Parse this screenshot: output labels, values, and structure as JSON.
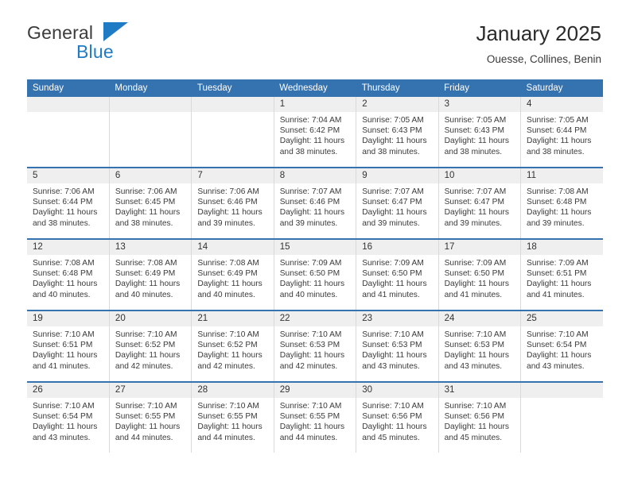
{
  "brand": {
    "name_part1": "General",
    "name_part2": "Blue",
    "triangle_icon": "triangle-icon",
    "accent_color": "#1f7cc4"
  },
  "header": {
    "title": "January 2025",
    "location": "Ouesse, Collines, Benin"
  },
  "theme": {
    "header_blue": "#3572b0",
    "daynum_gray": "#efefef",
    "text": "#333333"
  },
  "weekday_headers": [
    "Sunday",
    "Monday",
    "Tuesday",
    "Wednesday",
    "Thursday",
    "Friday",
    "Saturday"
  ],
  "labels": {
    "sunrise_prefix": "Sunrise:",
    "sunset_prefix": "Sunset:",
    "daylight_prefix": "Daylight:"
  },
  "weeks": [
    [
      {
        "day": "",
        "empty": true
      },
      {
        "day": "",
        "empty": true
      },
      {
        "day": "",
        "empty": true
      },
      {
        "day": "1",
        "sunrise": "Sunrise: 7:04 AM",
        "sunset": "Sunset: 6:42 PM",
        "daylight_line1": "Daylight: 11 hours",
        "daylight_line2": "and 38 minutes."
      },
      {
        "day": "2",
        "sunrise": "Sunrise: 7:05 AM",
        "sunset": "Sunset: 6:43 PM",
        "daylight_line1": "Daylight: 11 hours",
        "daylight_line2": "and 38 minutes."
      },
      {
        "day": "3",
        "sunrise": "Sunrise: 7:05 AM",
        "sunset": "Sunset: 6:43 PM",
        "daylight_line1": "Daylight: 11 hours",
        "daylight_line2": "and 38 minutes."
      },
      {
        "day": "4",
        "sunrise": "Sunrise: 7:05 AM",
        "sunset": "Sunset: 6:44 PM",
        "daylight_line1": "Daylight: 11 hours",
        "daylight_line2": "and 38 minutes."
      }
    ],
    [
      {
        "day": "5",
        "sunrise": "Sunrise: 7:06 AM",
        "sunset": "Sunset: 6:44 PM",
        "daylight_line1": "Daylight: 11 hours",
        "daylight_line2": "and 38 minutes."
      },
      {
        "day": "6",
        "sunrise": "Sunrise: 7:06 AM",
        "sunset": "Sunset: 6:45 PM",
        "daylight_line1": "Daylight: 11 hours",
        "daylight_line2": "and 38 minutes."
      },
      {
        "day": "7",
        "sunrise": "Sunrise: 7:06 AM",
        "sunset": "Sunset: 6:46 PM",
        "daylight_line1": "Daylight: 11 hours",
        "daylight_line2": "and 39 minutes."
      },
      {
        "day": "8",
        "sunrise": "Sunrise: 7:07 AM",
        "sunset": "Sunset: 6:46 PM",
        "daylight_line1": "Daylight: 11 hours",
        "daylight_line2": "and 39 minutes."
      },
      {
        "day": "9",
        "sunrise": "Sunrise: 7:07 AM",
        "sunset": "Sunset: 6:47 PM",
        "daylight_line1": "Daylight: 11 hours",
        "daylight_line2": "and 39 minutes."
      },
      {
        "day": "10",
        "sunrise": "Sunrise: 7:07 AM",
        "sunset": "Sunset: 6:47 PM",
        "daylight_line1": "Daylight: 11 hours",
        "daylight_line2": "and 39 minutes."
      },
      {
        "day": "11",
        "sunrise": "Sunrise: 7:08 AM",
        "sunset": "Sunset: 6:48 PM",
        "daylight_line1": "Daylight: 11 hours",
        "daylight_line2": "and 39 minutes."
      }
    ],
    [
      {
        "day": "12",
        "sunrise": "Sunrise: 7:08 AM",
        "sunset": "Sunset: 6:48 PM",
        "daylight_line1": "Daylight: 11 hours",
        "daylight_line2": "and 40 minutes."
      },
      {
        "day": "13",
        "sunrise": "Sunrise: 7:08 AM",
        "sunset": "Sunset: 6:49 PM",
        "daylight_line1": "Daylight: 11 hours",
        "daylight_line2": "and 40 minutes."
      },
      {
        "day": "14",
        "sunrise": "Sunrise: 7:08 AM",
        "sunset": "Sunset: 6:49 PM",
        "daylight_line1": "Daylight: 11 hours",
        "daylight_line2": "and 40 minutes."
      },
      {
        "day": "15",
        "sunrise": "Sunrise: 7:09 AM",
        "sunset": "Sunset: 6:50 PM",
        "daylight_line1": "Daylight: 11 hours",
        "daylight_line2": "and 40 minutes."
      },
      {
        "day": "16",
        "sunrise": "Sunrise: 7:09 AM",
        "sunset": "Sunset: 6:50 PM",
        "daylight_line1": "Daylight: 11 hours",
        "daylight_line2": "and 41 minutes."
      },
      {
        "day": "17",
        "sunrise": "Sunrise: 7:09 AM",
        "sunset": "Sunset: 6:50 PM",
        "daylight_line1": "Daylight: 11 hours",
        "daylight_line2": "and 41 minutes."
      },
      {
        "day": "18",
        "sunrise": "Sunrise: 7:09 AM",
        "sunset": "Sunset: 6:51 PM",
        "daylight_line1": "Daylight: 11 hours",
        "daylight_line2": "and 41 minutes."
      }
    ],
    [
      {
        "day": "19",
        "sunrise": "Sunrise: 7:10 AM",
        "sunset": "Sunset: 6:51 PM",
        "daylight_line1": "Daylight: 11 hours",
        "daylight_line2": "and 41 minutes."
      },
      {
        "day": "20",
        "sunrise": "Sunrise: 7:10 AM",
        "sunset": "Sunset: 6:52 PM",
        "daylight_line1": "Daylight: 11 hours",
        "daylight_line2": "and 42 minutes."
      },
      {
        "day": "21",
        "sunrise": "Sunrise: 7:10 AM",
        "sunset": "Sunset: 6:52 PM",
        "daylight_line1": "Daylight: 11 hours",
        "daylight_line2": "and 42 minutes."
      },
      {
        "day": "22",
        "sunrise": "Sunrise: 7:10 AM",
        "sunset": "Sunset: 6:53 PM",
        "daylight_line1": "Daylight: 11 hours",
        "daylight_line2": "and 42 minutes."
      },
      {
        "day": "23",
        "sunrise": "Sunrise: 7:10 AM",
        "sunset": "Sunset: 6:53 PM",
        "daylight_line1": "Daylight: 11 hours",
        "daylight_line2": "and 43 minutes."
      },
      {
        "day": "24",
        "sunrise": "Sunrise: 7:10 AM",
        "sunset": "Sunset: 6:53 PM",
        "daylight_line1": "Daylight: 11 hours",
        "daylight_line2": "and 43 minutes."
      },
      {
        "day": "25",
        "sunrise": "Sunrise: 7:10 AM",
        "sunset": "Sunset: 6:54 PM",
        "daylight_line1": "Daylight: 11 hours",
        "daylight_line2": "and 43 minutes."
      }
    ],
    [
      {
        "day": "26",
        "sunrise": "Sunrise: 7:10 AM",
        "sunset": "Sunset: 6:54 PM",
        "daylight_line1": "Daylight: 11 hours",
        "daylight_line2": "and 43 minutes."
      },
      {
        "day": "27",
        "sunrise": "Sunrise: 7:10 AM",
        "sunset": "Sunset: 6:55 PM",
        "daylight_line1": "Daylight: 11 hours",
        "daylight_line2": "and 44 minutes."
      },
      {
        "day": "28",
        "sunrise": "Sunrise: 7:10 AM",
        "sunset": "Sunset: 6:55 PM",
        "daylight_line1": "Daylight: 11 hours",
        "daylight_line2": "and 44 minutes."
      },
      {
        "day": "29",
        "sunrise": "Sunrise: 7:10 AM",
        "sunset": "Sunset: 6:55 PM",
        "daylight_line1": "Daylight: 11 hours",
        "daylight_line2": "and 44 minutes."
      },
      {
        "day": "30",
        "sunrise": "Sunrise: 7:10 AM",
        "sunset": "Sunset: 6:56 PM",
        "daylight_line1": "Daylight: 11 hours",
        "daylight_line2": "and 45 minutes."
      },
      {
        "day": "31",
        "sunrise": "Sunrise: 7:10 AM",
        "sunset": "Sunset: 6:56 PM",
        "daylight_line1": "Daylight: 11 hours",
        "daylight_line2": "and 45 minutes."
      },
      {
        "day": "",
        "empty": true
      }
    ]
  ]
}
